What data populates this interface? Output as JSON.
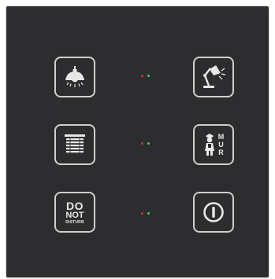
{
  "panel": {
    "rows": [
      {
        "left": {
          "name": "ceiling-lamp-button",
          "icon": "ceiling-lamp-icon"
        },
        "right": {
          "name": "desk-lamp-button",
          "icon": "desk-lamp-icon"
        }
      },
      {
        "left": {
          "name": "blinds-button",
          "icon": "window-blinds-icon"
        },
        "right": {
          "name": "make-up-room-button",
          "icon": "maid-icon",
          "label_letters": [
            "M",
            "U",
            "R"
          ]
        }
      },
      {
        "left": {
          "name": "do-not-disturb-button",
          "label_line1": "DO",
          "label_line2": "NOT",
          "label_line3": "DISTURB"
        },
        "right": {
          "name": "power-button",
          "icon": "power-icon"
        }
      }
    ],
    "indicator_colors": {
      "red": "#d8322c",
      "green": "#3fd04a"
    },
    "panel_color": "#2d2d2f",
    "icon_color": "#e8e8e8"
  }
}
